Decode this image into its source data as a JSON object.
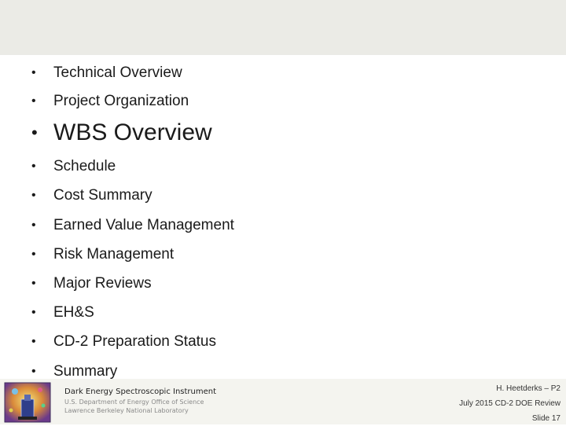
{
  "agenda": {
    "items": [
      {
        "label": "Technical Overview"
      },
      {
        "label": "Project Organization"
      },
      {
        "label": "WBS Overview"
      },
      {
        "label": "Schedule"
      },
      {
        "label": "Cost Summary"
      },
      {
        "label": "Earned Value Management"
      },
      {
        "label": "Risk Management"
      },
      {
        "label": "Major Reviews"
      },
      {
        "label": "EH&S"
      },
      {
        "label": "CD-2 Preparation Status"
      },
      {
        "label": "Summary"
      }
    ],
    "bullet": "•"
  },
  "footer": {
    "instrument": "Dark Energy Spectroscopic Instrument",
    "department": "U.S. Department of Energy Office of Science",
    "lab": "Lawrence Berkeley National Laboratory",
    "author": "H. Heetderks – P2",
    "review": "July 2015 CD-2 DOE Review",
    "slide": "Slide 17"
  },
  "colors": {
    "header_band": "#ebebe6",
    "footer_band": "#f4f4ef"
  }
}
